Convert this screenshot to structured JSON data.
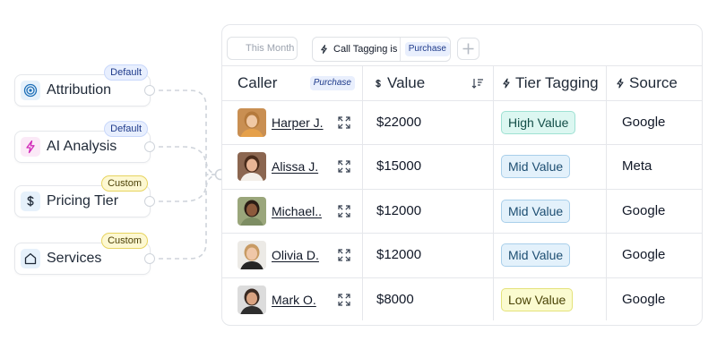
{
  "nodes": [
    {
      "label": "Attribution",
      "badge": "Default",
      "badge_type": "default",
      "icon": "target-icon",
      "icon_bg": "#e6f1fb"
    },
    {
      "label": "AI Analysis",
      "badge": "Default",
      "badge_type": "default",
      "icon": "lightning-icon",
      "icon_bg": "#fbe9f7"
    },
    {
      "label": "Pricing Tier",
      "badge": "Custom",
      "badge_type": "custom",
      "icon": "dollar-icon",
      "icon_bg": "#e6f1fb"
    },
    {
      "label": "Services",
      "badge": "Custom",
      "badge_type": "custom",
      "icon": "home-icon",
      "icon_bg": "#e6f1fb"
    }
  ],
  "toolbar": {
    "date_placeholder": "This Month",
    "filter_label": "Call Tagging is",
    "filter_value": "Purchase",
    "add_icon": "plus-icon"
  },
  "columns": {
    "caller": "Caller",
    "caller_pill": "Purchase",
    "value": "Value",
    "tier": "Tier Tagging",
    "source": "Source"
  },
  "rows": [
    {
      "name": "Harper J.",
      "value": "$22000",
      "tier": "High Value",
      "tier_type": "high",
      "source": "Google",
      "avatar": {
        "bg": "#c98f52",
        "skin": "#f0c8a4",
        "hair": "#b57a3c",
        "shirt": "#e5a04a"
      }
    },
    {
      "name": "Alissa J.",
      "value": "$15000",
      "tier": "Mid Value",
      "tier_type": "mid",
      "source": "Meta",
      "avatar": {
        "bg": "#8b6650",
        "skin": "#e8b596",
        "hair": "#4a2c1c",
        "shirt": "#f3eee8"
      }
    },
    {
      "name": "Michael..",
      "value": "$12000",
      "tier": "Mid Value",
      "tier_type": "mid",
      "source": "Google",
      "avatar": {
        "bg": "#9aa67b",
        "skin": "#8d5a3c",
        "hair": "#2a1c14",
        "shirt": "#7d8d63"
      }
    },
    {
      "name": "Olivia D.",
      "value": "$12000",
      "tier": "Mid Value",
      "tier_type": "mid",
      "source": "Google",
      "avatar": {
        "bg": "#eceae6",
        "skin": "#efc7a8",
        "hair": "#c89b64",
        "shirt": "#252525"
      }
    },
    {
      "name": "Mark O.",
      "value": "$8000",
      "tier": "Low Value",
      "tier_type": "low",
      "source": "Google",
      "avatar": {
        "bg": "#dcdcdc",
        "skin": "#d9a381",
        "hair": "#3a2a22",
        "shirt": "#2e2e2e"
      }
    }
  ],
  "colors": {
    "border": "#e5e7eb",
    "connector": "#cfd4db",
    "icon_accent": "#1e6fb8",
    "ai_accent": "#d128b8"
  }
}
